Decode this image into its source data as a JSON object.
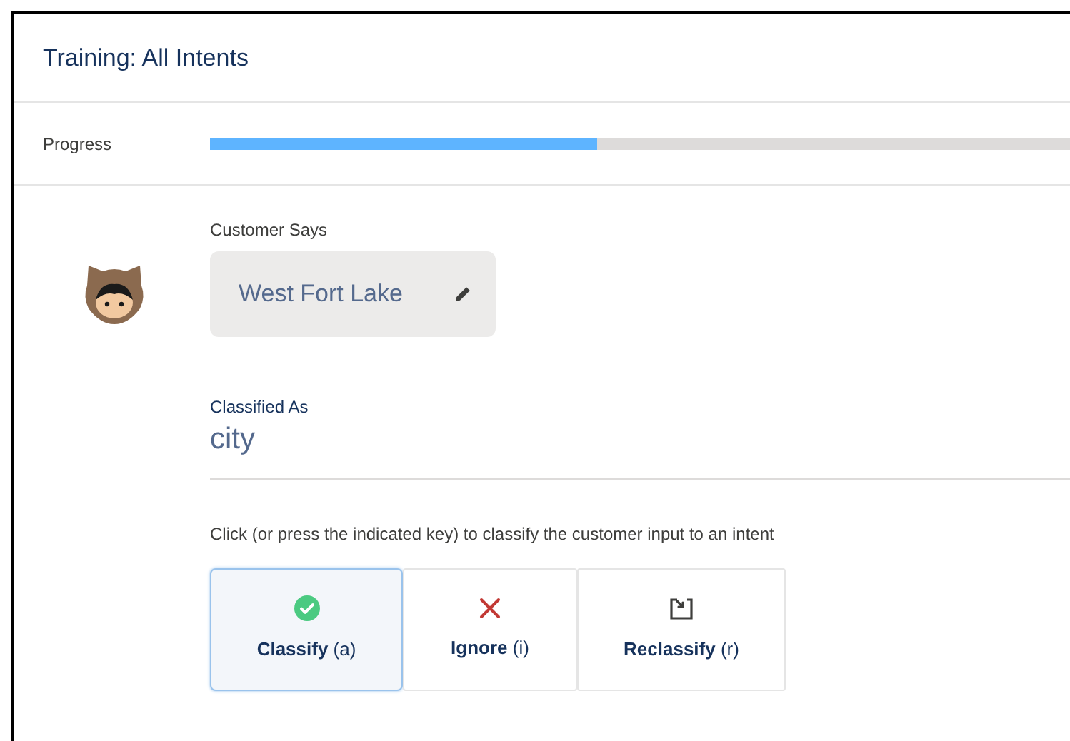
{
  "panel": {
    "title": "Training: All Intents"
  },
  "progress": {
    "label": "Progress",
    "level": 0.45
  },
  "customer": {
    "label": "Customer Says",
    "utterance": "West Fort Lake"
  },
  "classification": {
    "label": "Classified As",
    "value": "city"
  },
  "instruction": "Click (or press the indicated key) to classify the customer input to an intent",
  "actions": [
    {
      "kind": "classify",
      "label": "**Classify** (a)",
      "selected": true
    },
    {
      "kind": "ignore",
      "label": "**Ignore** (i)",
      "selected": false
    },
    {
      "kind": "reclassify",
      "label": "**Reclassify** (r)",
      "selected": false
    }
  ]
}
